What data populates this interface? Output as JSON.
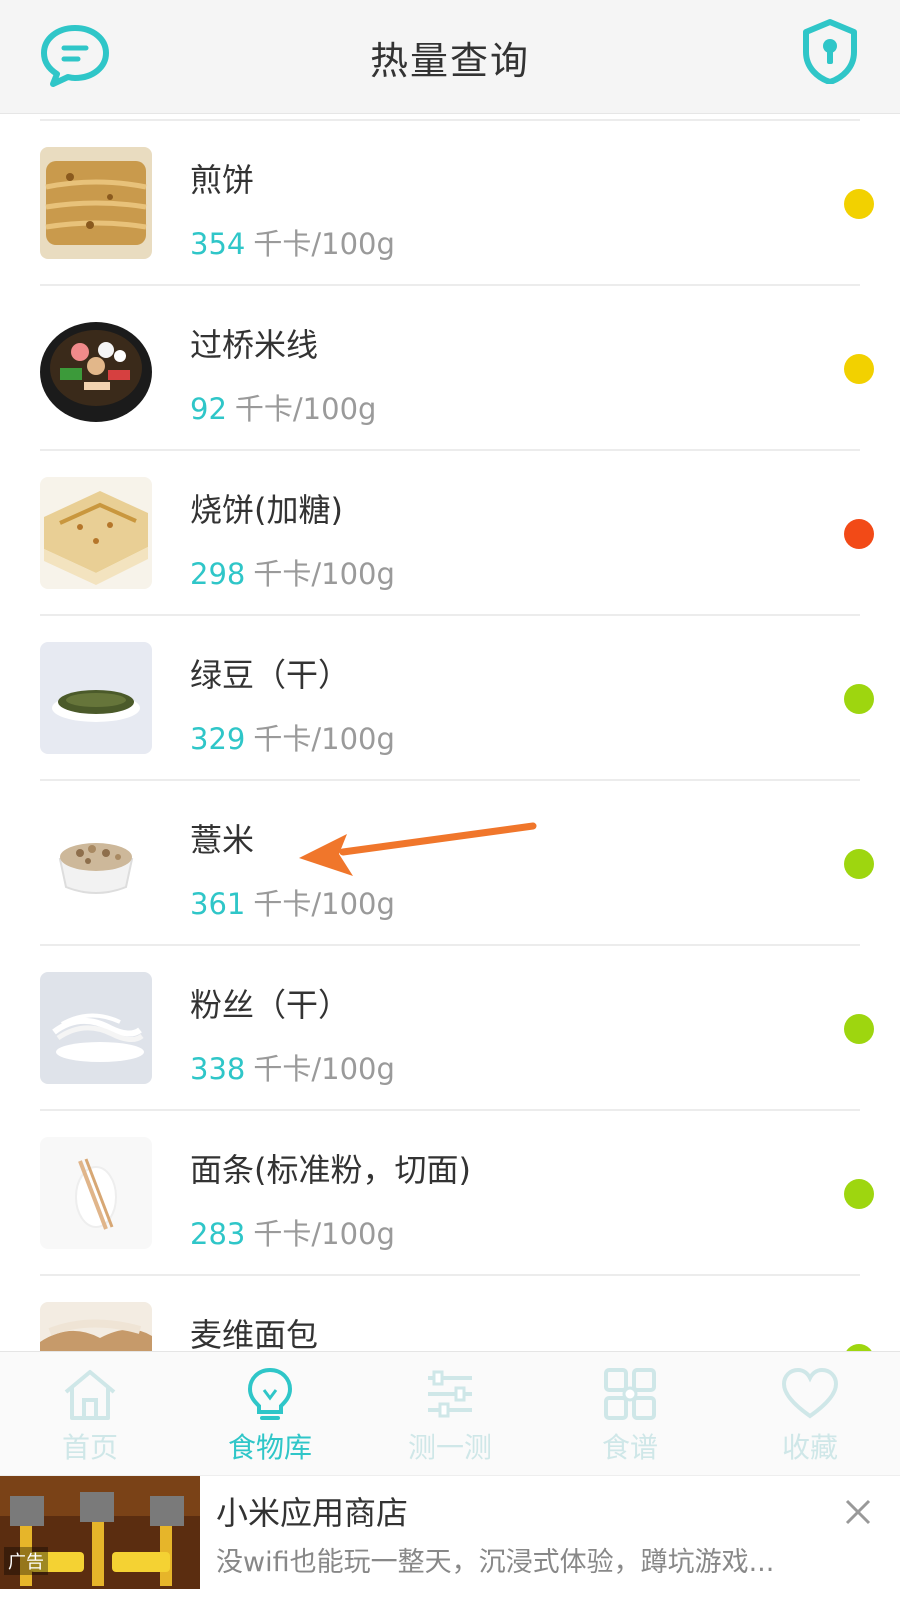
{
  "header": {
    "title": "热量查询",
    "left_icon": "chat-bubble-icon",
    "right_icon": "shield-lock-icon"
  },
  "colors": {
    "accent": "#2fc6c8",
    "dot_yellow": "#f2d100",
    "dot_red": "#f24a17",
    "dot_green": "#9ed60f"
  },
  "foods": [
    {
      "name": "煎饼",
      "calories": "354",
      "unit": "千卡/100g",
      "level": "yellow"
    },
    {
      "name": "过桥米线",
      "calories": "92",
      "unit": "千卡/100g",
      "level": "yellow"
    },
    {
      "name": "烧饼(加糖)",
      "calories": "298",
      "unit": "千卡/100g",
      "level": "red"
    },
    {
      "name": "绿豆（干）",
      "calories": "329",
      "unit": "千卡/100g",
      "level": "green"
    },
    {
      "name": "薏米",
      "calories": "361",
      "unit": "千卡/100g",
      "level": "green"
    },
    {
      "name": "粉丝（干）",
      "calories": "338",
      "unit": "千卡/100g",
      "level": "green"
    },
    {
      "name": "面条(标准粉，切面)",
      "calories": "283",
      "unit": "千卡/100g",
      "level": "green"
    },
    {
      "name": "麦维面包",
      "calories": "",
      "unit": "",
      "level": "green"
    }
  ],
  "tabs": [
    {
      "label": "首页",
      "icon": "home-icon"
    },
    {
      "label": "食物库",
      "icon": "lightbulb-icon",
      "active": true
    },
    {
      "label": "测一测",
      "icon": "sliders-icon"
    },
    {
      "label": "食谱",
      "icon": "grid-icon"
    },
    {
      "label": "收藏",
      "icon": "heart-icon"
    }
  ],
  "ad": {
    "title": "小米应用商店",
    "description": "没wifi也能玩一整天，沉浸式体验，蹲坑游戏...",
    "tag": "广告"
  }
}
